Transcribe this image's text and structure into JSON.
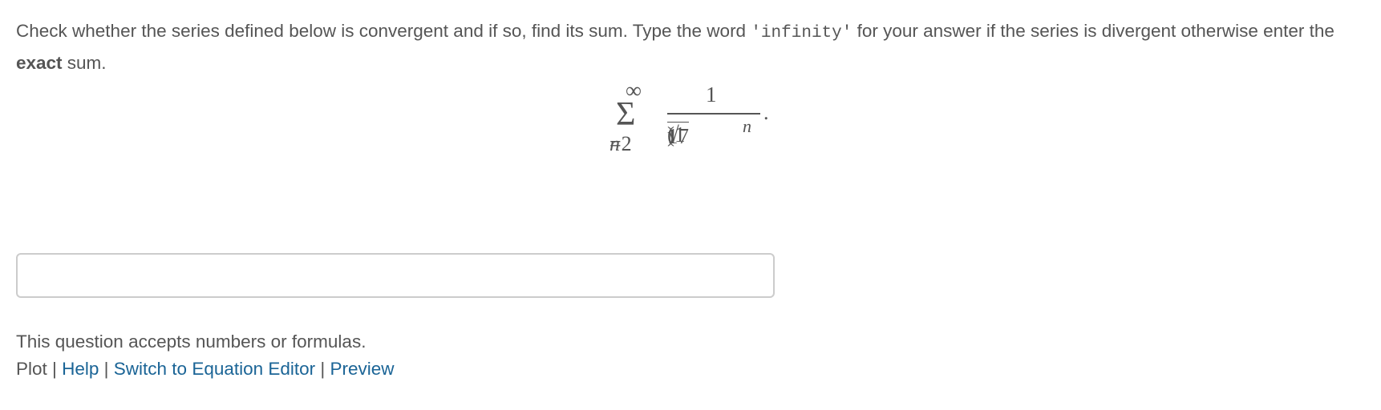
{
  "question": {
    "part1": "Check whether the series defined below is convergent and if so, find its sum. Type the word ",
    "code_word": "'infinity'",
    "part2": " for your answer if the series is divergent otherwise enter the ",
    "bold_word": "exact",
    "part3": " sum."
  },
  "formula": {
    "upper_limit": "∞",
    "sigma": "Σ",
    "lower_var": "n",
    "lower_eq": "=2",
    "numerator": "1",
    "den_open": "(1",
    "den_sqrt": "√",
    "den_radicand": "17",
    "den_close": ")",
    "exponent": "n",
    "trailing": "."
  },
  "answer": {
    "value": "",
    "placeholder": ""
  },
  "footer": {
    "note": "This question accepts numbers or formulas.",
    "plot": "Plot",
    "sep": " | ",
    "help": "Help",
    "equation_editor": "Switch to Equation Editor",
    "preview": "Preview"
  }
}
